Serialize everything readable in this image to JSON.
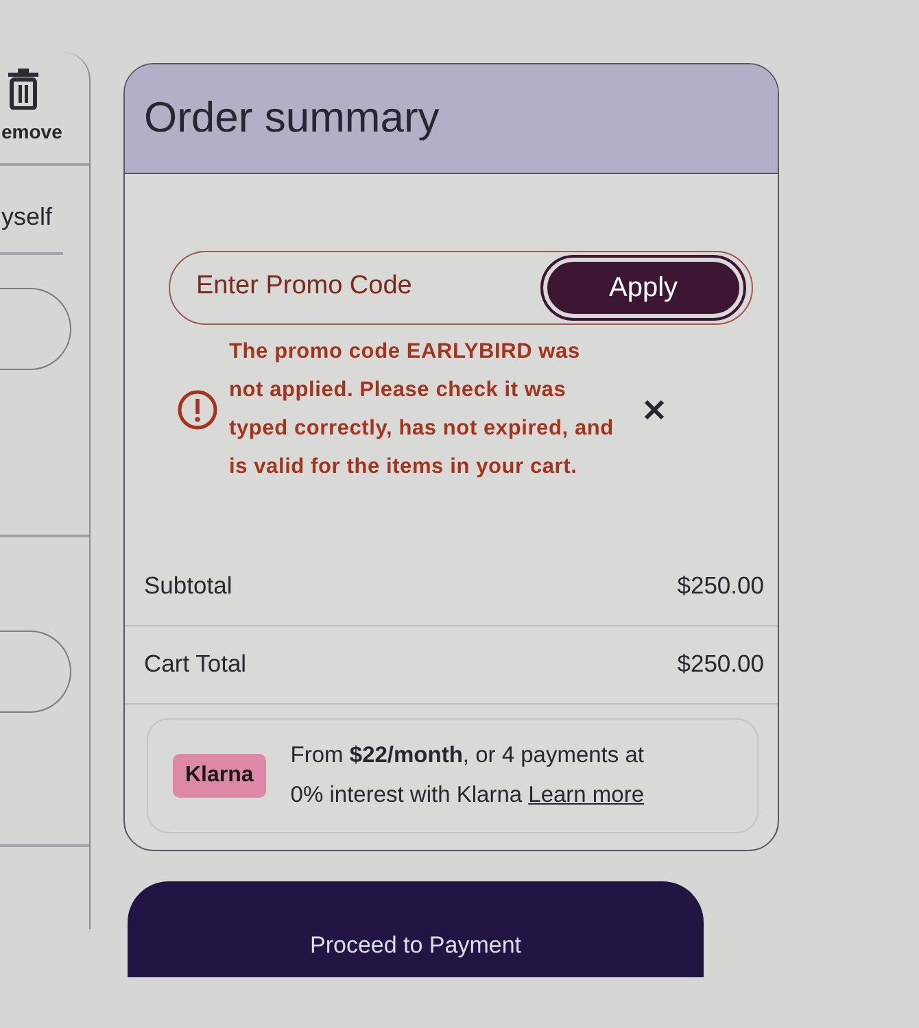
{
  "sidebar": {
    "remove_label": "emove",
    "name_fragment": "yself",
    "fields": [
      {
        "kind": "input"
      },
      {
        "kind": "input"
      }
    ]
  },
  "order_summary": {
    "title": "Order summary",
    "promo": {
      "placeholder": "Enter Promo Code",
      "button": "Apply"
    },
    "error": {
      "message": "The promo code EARLYBIRD was not applied. Please check it was typed correctly, has not expired, and is valid for the items in your cart.",
      "dismissible": true
    },
    "totals": [
      {
        "label": "Subtotal",
        "value": "$250.00"
      },
      {
        "label": "Cart Total",
        "value": "$250.00"
      }
    ],
    "klarna": {
      "badge": "Klarna",
      "text": "From **$22/month**, or 4 payments at 0% interest with Klarna",
      "link": "Learn more"
    }
  },
  "proceed_button": "Proceed to Payment"
}
